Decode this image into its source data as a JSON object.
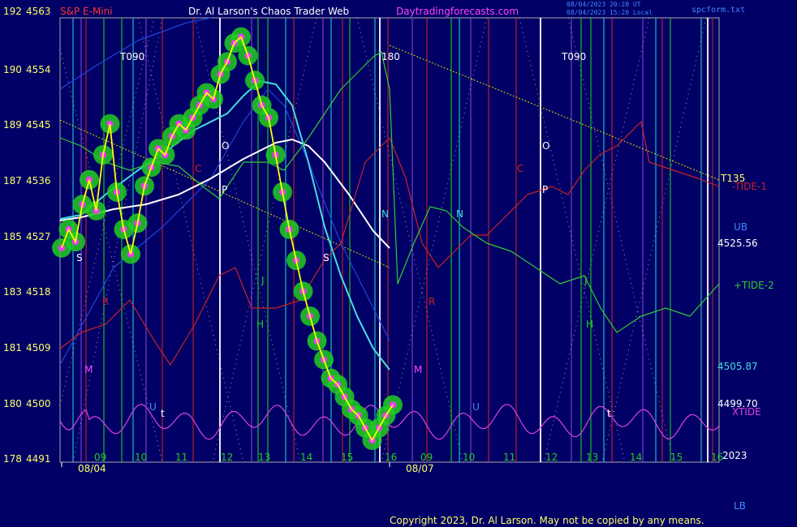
{
  "header": {
    "left_title": "S&P E-Mini",
    "center_title": "Dr. Al Larson's Chaos Trader Web",
    "site": "Daytradingforecasts.com",
    "ut_stamp": "08/04/2023 20:20 UT",
    "local_stamp": "08/04/2023 15:20 Local",
    "file": "spcform.txt"
  },
  "footer": {
    "copyright": "Copyright 2023, Dr. Al Larson. May not be copied by any means."
  },
  "colors": {
    "background": "#000066",
    "price": "#ffff00",
    "price_glow": "#22cc22",
    "price_dots": "#ff33ff",
    "tide_1": "#cc2222",
    "tide_2": "#33cc33",
    "xtide": "#dd44dd",
    "cyan_avg": "#44dddd",
    "white_avg": "#ffffff",
    "blue_band": "#2244dd",
    "yellow_trend": "#dddd00",
    "vline_red": "#cc2222",
    "vline_green": "#22cc22",
    "vline_cyan": "#22cccc",
    "vline_white": "#ffffff",
    "vline_purple": "#8844cc"
  },
  "chart_data": {
    "type": "line",
    "y_axis_left": [
      {
        "tide": "192",
        "price": "4563"
      },
      {
        "tide": "190",
        "price": "4554"
      },
      {
        "tide": "189",
        "price": "4545"
      },
      {
        "tide": "187",
        "price": "4536"
      },
      {
        "tide": "185",
        "price": "4527"
      },
      {
        "tide": "183",
        "price": "4518"
      },
      {
        "tide": "181",
        "price": "4509"
      },
      {
        "tide": "180",
        "price": "4500"
      },
      {
        "tide": "178",
        "price": "4491"
      }
    ],
    "ylim": [
      4491,
      4563
    ],
    "hour_labels": [
      "09",
      "10",
      "11",
      "12",
      "13",
      "14",
      "15",
      "16",
      "09",
      "10",
      "11",
      "12",
      "13",
      "14",
      "15",
      "16"
    ],
    "date_labels": [
      "08/04",
      "08/07"
    ],
    "right_labels": [
      "T135",
      "-TIDE-1",
      "UB",
      "4525.56",
      "+TIDE-2",
      "4505.87",
      "4499.70",
      "XTIDE",
      "2023",
      "LB"
    ],
    "planet_labels": [
      "T090",
      "180",
      "T090",
      "O",
      "P",
      "C",
      "S",
      "J",
      "H",
      "N",
      "R",
      "M",
      "t",
      "U",
      "O",
      "P",
      "C",
      "S",
      "J",
      "H",
      "N",
      "R",
      "M",
      "t",
      "U"
    ],
    "price_series": [
      [
        0,
        4525
      ],
      [
        0.5,
        4528
      ],
      [
        1,
        4526
      ],
      [
        1.5,
        4532
      ],
      [
        2,
        4536
      ],
      [
        2.5,
        4531
      ],
      [
        3,
        4540
      ],
      [
        3.5,
        4545
      ],
      [
        4,
        4534
      ],
      [
        4.5,
        4528
      ],
      [
        5,
        4524
      ],
      [
        5.5,
        4529
      ],
      [
        6,
        4535
      ],
      [
        6.5,
        4538
      ],
      [
        7,
        4541
      ],
      [
        7.5,
        4540
      ],
      [
        8,
        4543
      ],
      [
        8.5,
        4545
      ],
      [
        9,
        4544
      ],
      [
        9.5,
        4546
      ],
      [
        10,
        4548
      ],
      [
        10.5,
        4550
      ],
      [
        11,
        4549
      ],
      [
        11.5,
        4553
      ],
      [
        12,
        4555
      ],
      [
        12.5,
        4558
      ],
      [
        13,
        4559
      ],
      [
        13.5,
        4556
      ],
      [
        14,
        4552
      ],
      [
        14.5,
        4548
      ],
      [
        15,
        4546
      ],
      [
        15.5,
        4540
      ],
      [
        16,
        4534
      ],
      [
        16.5,
        4528
      ],
      [
        17,
        4523
      ],
      [
        17.5,
        4518
      ],
      [
        18,
        4514
      ],
      [
        18.5,
        4510
      ],
      [
        19,
        4507
      ],
      [
        19.5,
        4504
      ],
      [
        20,
        4503
      ],
      [
        20.5,
        4501
      ],
      [
        21,
        4499
      ],
      [
        21.5,
        4498
      ],
      [
        22,
        4496
      ],
      [
        22.5,
        4494
      ],
      [
        23,
        4496
      ],
      [
        23.5,
        4498
      ],
      [
        24,
        4499.7
      ]
    ],
    "annotation_values": {
      "upper_band": "4525.56",
      "cyan_avg": "4505.87",
      "last": "4499.70"
    }
  }
}
